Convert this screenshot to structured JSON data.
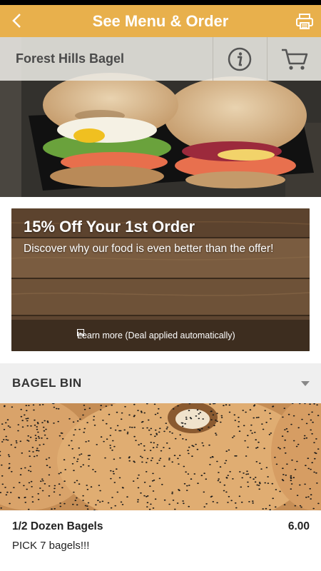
{
  "app_bar": {
    "title": "See Menu & Order",
    "back_icon": "chevron-left-icon",
    "print_icon": "printer-icon",
    "background": "#e8b04c"
  },
  "restaurant": {
    "name": "Forest Hills Bagel",
    "info_icon": "info-icon",
    "cart_icon": "cart-icon"
  },
  "promo": {
    "headline": "15% Off Your 1st Order",
    "subtext": "Discover why our food is even better than the offer!",
    "learn_more": "Learn more (Deal applied automatically)",
    "learn_icon": "image-icon"
  },
  "menu": {
    "section_title": "BAGEL BIN",
    "section_icon": "caret-down-icon",
    "items": [
      {
        "name": "1/2 Dozen Bagels",
        "price": "6.00",
        "description": "PICK 7 bagels!!!"
      }
    ]
  }
}
